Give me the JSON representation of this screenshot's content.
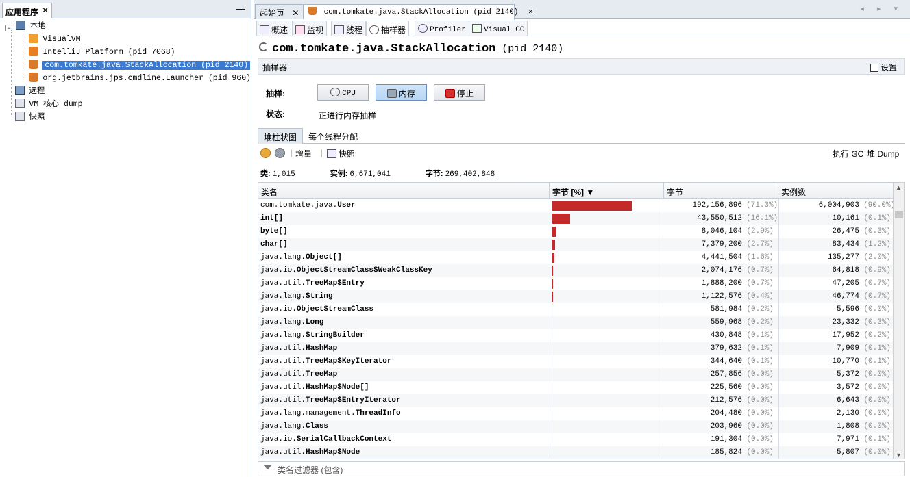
{
  "left_panel": {
    "tab_label": "应用程序",
    "close": "✕",
    "minimize": "—",
    "tree": {
      "local": "本地",
      "local_items": [
        {
          "label": "VisualVM",
          "icon": "visualvm-icon"
        },
        {
          "label": "IntelliJ Platform (pid 7068)",
          "icon": "intellij-icon"
        },
        {
          "label": "com.tomkate.java.StackAllocation (pid 2140)",
          "icon": "java-cup-icon",
          "selected": true
        },
        {
          "label": "org.jetbrains.jps.cmdline.Launcher (pid 960)",
          "icon": "java-cup-icon"
        }
      ],
      "remote": "远程",
      "coredump": "VM 核心 dump",
      "snapshot": "快照"
    }
  },
  "doc_tabs": {
    "start": "起始页",
    "app": "com.tomkate.java.StackAllocation (pid 2140)",
    "close": "✕",
    "nav": "◂ ▸ ▾"
  },
  "sub_tabs": [
    "概述",
    "监视",
    "线程",
    "抽样器",
    "Profiler",
    "Visual GC"
  ],
  "app_title": "com.tomkate.java.StackAllocation",
  "app_pid": "(pid 2140)",
  "sampler": {
    "header": "抽样器",
    "settings": "设置",
    "sample_label": "抽样:",
    "cpu": "CPU",
    "memory": "内存",
    "stop": "停止",
    "status_label": "状态:",
    "status_value": "正进行内存抽样"
  },
  "inner_tabs": [
    "堆柱状图",
    "每个线程分配"
  ],
  "toolbar": {
    "delta": "增量",
    "snapshot": "快照",
    "gc": "执行 GC",
    "dump": "堆 Dump"
  },
  "stats": {
    "classes_label": "类:",
    "classes": "1,015",
    "instances_label": "实例:",
    "instances": "6,671,041",
    "bytes_label": "字节:",
    "bytes": "269,402,848"
  },
  "table": {
    "headers": [
      "类名",
      "字节 [%] ▼",
      "字节",
      "实例数"
    ],
    "rows": [
      {
        "pkg": "com.tomkate.java.",
        "cls": "User",
        "share": 71.3,
        "bytes": "192,156,896",
        "bpct": "(71.3%)",
        "inst": "6,004,903",
        "ipct": "(90.0%)"
      },
      {
        "pkg": "",
        "cls": "int[]",
        "share": 16.1,
        "bytes": "43,550,512",
        "bpct": "(16.1%)",
        "inst": "10,161",
        "ipct": "(0.1%)"
      },
      {
        "pkg": "",
        "cls": "byte[]",
        "share": 2.9,
        "bytes": "8,046,104",
        "bpct": "(2.9%)",
        "inst": "26,475",
        "ipct": "(0.3%)"
      },
      {
        "pkg": "",
        "cls": "char[]",
        "share": 2.7,
        "bytes": "7,379,200",
        "bpct": "(2.7%)",
        "inst": "83,434",
        "ipct": "(1.2%)"
      },
      {
        "pkg": "java.lang.",
        "cls": "Object[]",
        "share": 1.6,
        "bytes": "4,441,504",
        "bpct": "(1.6%)",
        "inst": "135,277",
        "ipct": "(2.0%)"
      },
      {
        "pkg": "java.io.",
        "cls": "ObjectStreamClass$WeakClassKey",
        "share": 0.7,
        "bytes": "2,074,176",
        "bpct": "(0.7%)",
        "inst": "64,818",
        "ipct": "(0.9%)"
      },
      {
        "pkg": "java.util.",
        "cls": "TreeMap$Entry",
        "share": 0.7,
        "bytes": "1,888,200",
        "bpct": "(0.7%)",
        "inst": "47,205",
        "ipct": "(0.7%)"
      },
      {
        "pkg": "java.lang.",
        "cls": "String",
        "share": 0.4,
        "bytes": "1,122,576",
        "bpct": "(0.4%)",
        "inst": "46,774",
        "ipct": "(0.7%)"
      },
      {
        "pkg": "java.io.",
        "cls": "ObjectStreamClass",
        "share": 0.2,
        "bytes": "581,984",
        "bpct": "(0.2%)",
        "inst": "5,596",
        "ipct": "(0.0%)"
      },
      {
        "pkg": "java.lang.",
        "cls": "Long",
        "share": 0.2,
        "bytes": "559,968",
        "bpct": "(0.2%)",
        "inst": "23,332",
        "ipct": "(0.3%)"
      },
      {
        "pkg": "java.lang.",
        "cls": "StringBuilder",
        "share": 0.1,
        "bytes": "430,848",
        "bpct": "(0.1%)",
        "inst": "17,952",
        "ipct": "(0.2%)"
      },
      {
        "pkg": "java.util.",
        "cls": "HashMap",
        "share": 0.1,
        "bytes": "379,632",
        "bpct": "(0.1%)",
        "inst": "7,909",
        "ipct": "(0.1%)"
      },
      {
        "pkg": "java.util.",
        "cls": "TreeMap$KeyIterator",
        "share": 0.1,
        "bytes": "344,640",
        "bpct": "(0.1%)",
        "inst": "10,770",
        "ipct": "(0.1%)"
      },
      {
        "pkg": "java.util.",
        "cls": "TreeMap",
        "share": 0.0,
        "bytes": "257,856",
        "bpct": "(0.0%)",
        "inst": "5,372",
        "ipct": "(0.0%)"
      },
      {
        "pkg": "java.util.",
        "cls": "HashMap$Node[]",
        "share": 0.0,
        "bytes": "225,560",
        "bpct": "(0.0%)",
        "inst": "3,572",
        "ipct": "(0.0%)"
      },
      {
        "pkg": "java.util.",
        "cls": "TreeMap$EntryIterator",
        "share": 0.0,
        "bytes": "212,576",
        "bpct": "(0.0%)",
        "inst": "6,643",
        "ipct": "(0.0%)"
      },
      {
        "pkg": "java.lang.management.",
        "cls": "ThreadInfo",
        "share": 0.0,
        "bytes": "204,480",
        "bpct": "(0.0%)",
        "inst": "2,130",
        "ipct": "(0.0%)"
      },
      {
        "pkg": "java.lang.",
        "cls": "Class",
        "share": 0.0,
        "bytes": "203,960",
        "bpct": "(0.0%)",
        "inst": "1,808",
        "ipct": "(0.0%)"
      },
      {
        "pkg": "java.io.",
        "cls": "SerialCallbackContext",
        "share": 0.0,
        "bytes": "191,304",
        "bpct": "(0.0%)",
        "inst": "7,971",
        "ipct": "(0.1%)"
      },
      {
        "pkg": "java.util.",
        "cls": "HashMap$Node",
        "share": 0.0,
        "bytes": "185,824",
        "bpct": "(0.0%)",
        "inst": "5,807",
        "ipct": "(0.0%)"
      }
    ]
  },
  "filter_placeholder": "类名过滤器 (包含)",
  "colors": {
    "bar": "#c42a2a",
    "selection": "#3b7ad1"
  }
}
